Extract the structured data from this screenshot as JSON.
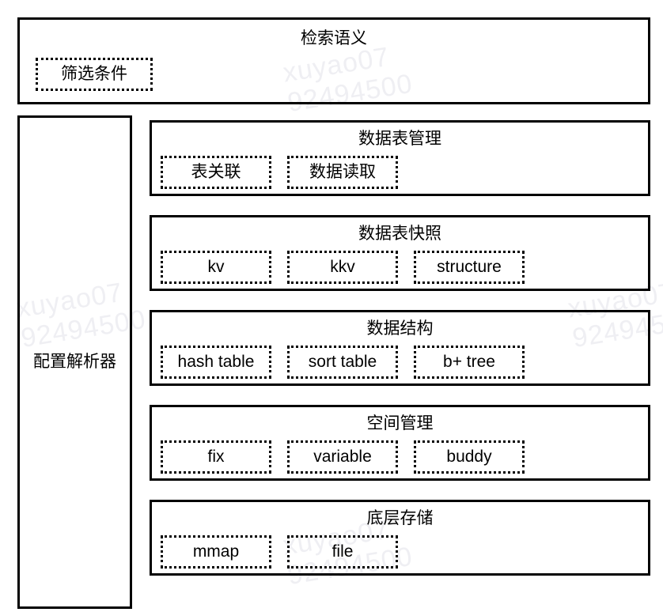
{
  "watermark": {
    "line1": "xuyao07",
    "line2": "92494500"
  },
  "top_section": {
    "title": "检索语义",
    "chips": [
      {
        "label": "筛选条件"
      }
    ]
  },
  "sidebar": {
    "label": "配置解析器"
  },
  "panels": [
    {
      "title": "数据表管理",
      "chips": [
        {
          "label": "表关联"
        },
        {
          "label": "数据读取"
        }
      ]
    },
    {
      "title": "数据表快照",
      "chips": [
        {
          "label": "kv"
        },
        {
          "label": "kkv"
        },
        {
          "label": "structure"
        }
      ]
    },
    {
      "title": "数据结构",
      "chips": [
        {
          "label": "hash table"
        },
        {
          "label": "sort table"
        },
        {
          "label": "b+ tree"
        }
      ]
    },
    {
      "title": "空间管理",
      "chips": [
        {
          "label": "fix"
        },
        {
          "label": "variable"
        },
        {
          "label": "buddy"
        }
      ]
    },
    {
      "title": "底层存储",
      "chips": [
        {
          "label": "mmap"
        },
        {
          "label": "file"
        }
      ]
    }
  ],
  "colors": {
    "border": "#000000",
    "text": "#000000",
    "background": "#ffffff",
    "watermark": "#efeff3"
  }
}
